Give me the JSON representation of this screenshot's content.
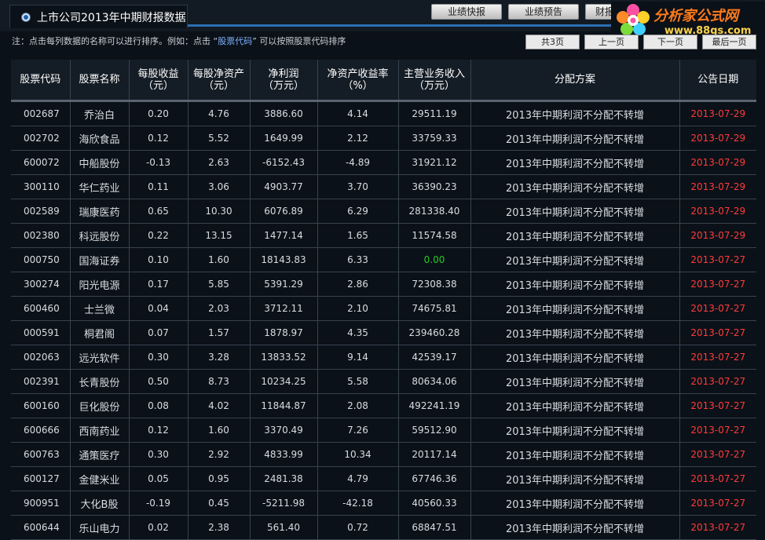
{
  "header": {
    "title": "上市公司2013年中期财报数据",
    "buttons": [
      "业绩快报",
      "业绩预告",
      "财报"
    ]
  },
  "logo": {
    "title": "分析家公式网",
    "url": "www.88gs.com"
  },
  "notice": {
    "before": "注：点击每列数据的名称可以进行排序。例如：点击 “",
    "link": "股票代码",
    "after": "” 可以按照股票代码排序"
  },
  "pager": {
    "total": "共3页",
    "prev": "上一页",
    "next": "下一页",
    "last": "最后一页"
  },
  "table": {
    "columns": [
      [
        "股票代码"
      ],
      [
        "股票名称"
      ],
      [
        "每股收益",
        "（元）"
      ],
      [
        "每股净资产",
        "（元）"
      ],
      [
        "净利润",
        "（万元）"
      ],
      [
        "净资产收益率",
        "（%）"
      ],
      [
        "主营业务收入",
        "（万元）"
      ],
      [
        "分配方案"
      ],
      [
        "公告日期"
      ]
    ],
    "rows": [
      [
        "002687",
        "乔治白",
        "0.20",
        "4.76",
        "3886.60",
        "4.14",
        "29511.19",
        "2013年中期利润不分配不转增",
        "2013-07-29"
      ],
      [
        "002702",
        "海欣食品",
        "0.12",
        "5.52",
        "1649.99",
        "2.12",
        "33759.33",
        "2013年中期利润不分配不转增",
        "2013-07-29"
      ],
      [
        "600072",
        "中船股份",
        "-0.13",
        "2.63",
        "-6152.43",
        "-4.89",
        "31921.12",
        "2013年中期利润不分配不转增",
        "2013-07-29"
      ],
      [
        "300110",
        "华仁药业",
        "0.11",
        "3.06",
        "4903.77",
        "3.70",
        "36390.23",
        "2013年中期利润不分配不转增",
        "2013-07-29"
      ],
      [
        "002589",
        "瑞康医药",
        "0.65",
        "10.30",
        "6076.89",
        "6.29",
        "281338.40",
        "2013年中期利润不分配不转增",
        "2013-07-29"
      ],
      [
        "002380",
        "科远股份",
        "0.22",
        "13.15",
        "1477.14",
        "1.65",
        "11574.58",
        "2013年中期利润不分配不转增",
        "2013-07-29"
      ],
      [
        "000750",
        "国海证券",
        "0.10",
        "1.60",
        "18143.83",
        "6.33",
        "0.00",
        "2013年中期利润不分配不转增",
        "2013-07-27"
      ],
      [
        "300274",
        "阳光电源",
        "0.17",
        "5.85",
        "5391.29",
        "2.86",
        "72308.38",
        "2013年中期利润不分配不转增",
        "2013-07-27"
      ],
      [
        "600460",
        "士兰微",
        "0.04",
        "2.03",
        "3712.11",
        "2.10",
        "74675.81",
        "2013年中期利润不分配不转增",
        "2013-07-27"
      ],
      [
        "000591",
        "桐君阁",
        "0.07",
        "1.57",
        "1878.97",
        "4.35",
        "239460.28",
        "2013年中期利润不分配不转增",
        "2013-07-27"
      ],
      [
        "002063",
        "远光软件",
        "0.30",
        "3.28",
        "13833.52",
        "9.14",
        "42539.17",
        "2013年中期利润不分配不转增",
        "2013-07-27"
      ],
      [
        "002391",
        "长青股份",
        "0.50",
        "8.73",
        "10234.25",
        "5.58",
        "80634.06",
        "2013年中期利润不分配不转增",
        "2013-07-27"
      ],
      [
        "600160",
        "巨化股份",
        "0.08",
        "4.02",
        "11844.87",
        "2.08",
        "492241.19",
        "2013年中期利润不分配不转增",
        "2013-07-27"
      ],
      [
        "600666",
        "西南药业",
        "0.12",
        "1.60",
        "3370.49",
        "7.26",
        "59512.90",
        "2013年中期利润不分配不转增",
        "2013-07-27"
      ],
      [
        "600763",
        "通策医疗",
        "0.30",
        "2.92",
        "4833.99",
        "10.34",
        "20117.14",
        "2013年中期利润不分配不转增",
        "2013-07-27"
      ],
      [
        "600127",
        "金健米业",
        "0.05",
        "0.95",
        "2481.38",
        "4.79",
        "67746.36",
        "2013年中期利润不分配不转增",
        "2013-07-27"
      ],
      [
        "900951",
        "大化B股",
        "-0.19",
        "0.45",
        "-5211.98",
        "-42.18",
        "40560.33",
        "2013年中期利润不分配不转增",
        "2013-07-27"
      ],
      [
        "600644",
        "乐山电力",
        "0.02",
        "2.38",
        "561.40",
        "0.72",
        "68847.51",
        "2013年中期利润不分配不转增",
        "2013-07-27"
      ]
    ]
  },
  "colors": {
    "background": "#0b1118",
    "accent_line": "#2d6fb3",
    "date": "#ff3b3b",
    "zero_value": "#22cc22"
  }
}
